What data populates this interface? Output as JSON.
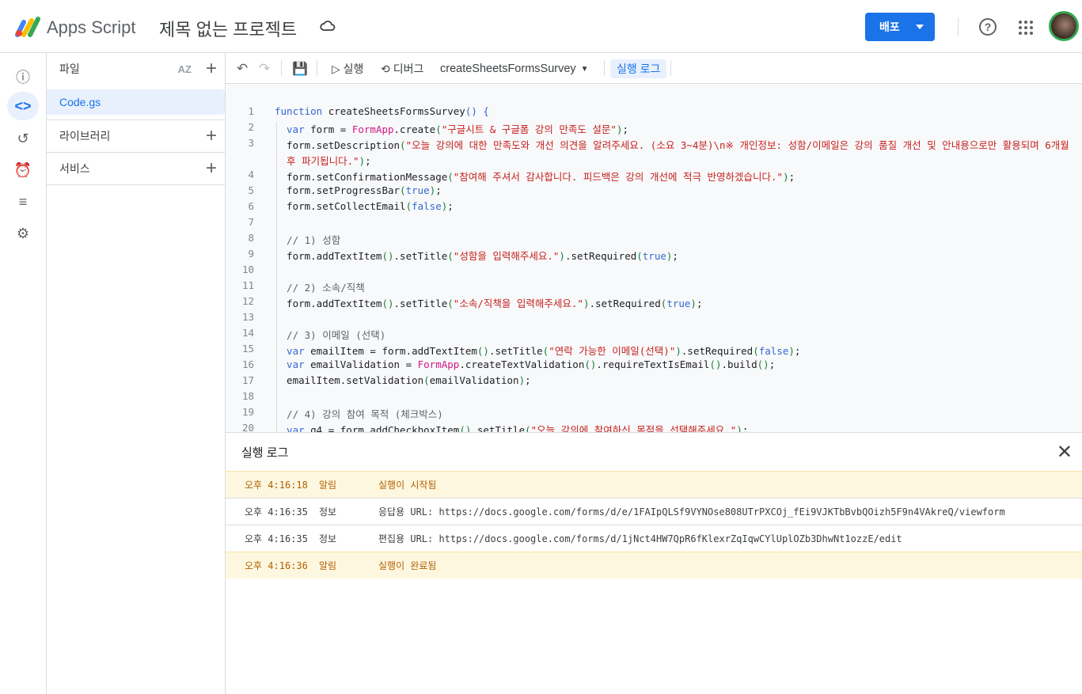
{
  "header": {
    "app_name": "Apps Script",
    "project_title": "제목 없는 프로젝트",
    "deploy_label": "배포",
    "help": "?"
  },
  "rail": [
    "info-icon",
    "code-icon",
    "history-icon",
    "trigger-icon",
    "executions-icon",
    "settings-icon"
  ],
  "files": {
    "title": "파일",
    "sort": "AZ",
    "items": [
      "Code.gs"
    ],
    "libraries": "라이브러리",
    "services": "서비스"
  },
  "toolbar": {
    "run": "▷ 실행",
    "debug": "디버그",
    "function": "createSheetsFormsSurvey",
    "log": "실행 로그"
  },
  "code": [
    {
      "n": "1",
      "seg": [
        [
          "k",
          "function "
        ],
        [
          "",
          "createSheetsFormsSurvey"
        ],
        [
          "k",
          "() {"
        ]
      ]
    },
    {
      "n": "2",
      "seg": [
        [
          "k",
          "  var "
        ],
        [
          "",
          "form = "
        ],
        [
          "cls",
          "FormApp"
        ],
        [
          "",
          ".create"
        ],
        [
          "p",
          "("
        ],
        [
          "s",
          "\"구글시트 & 구글폼 강의 만족도 설문\""
        ],
        [
          "p",
          ")"
        ],
        [
          "",
          ";"
        ]
      ]
    },
    {
      "n": "3",
      "seg": [
        [
          "",
          "  form.setDescription"
        ],
        [
          "p",
          "("
        ],
        [
          "s",
          "\"오늘 강의에 대한 만족도와 개선 의견을 알려주세요. (소요 3~4분)\\n※ 개인정보: 성함/이메일은 강의 품질 개선 및 안내용으로만 활용되며 6개월"
        ]
      ]
    },
    {
      "n": "",
      "seg": [
        [
          "s",
          "  후 파기됩니다.\""
        ],
        [
          "p",
          ")"
        ],
        [
          "",
          ";"
        ]
      ]
    },
    {
      "n": "4",
      "seg": [
        [
          "",
          "  form.setConfirmationMessage"
        ],
        [
          "p",
          "("
        ],
        [
          "s",
          "\"참여해 주셔서 감사합니다. 피드백은 강의 개선에 적극 반영하겠습니다.\""
        ],
        [
          "p",
          ")"
        ],
        [
          "",
          ";"
        ]
      ]
    },
    {
      "n": "5",
      "seg": [
        [
          "",
          "  form.setProgressBar"
        ],
        [
          "p",
          "("
        ],
        [
          "k",
          "true"
        ],
        [
          "p",
          ")"
        ],
        [
          "",
          ";"
        ]
      ]
    },
    {
      "n": "6",
      "seg": [
        [
          "",
          "  form.setCollectEmail"
        ],
        [
          "p",
          "("
        ],
        [
          "k",
          "false"
        ],
        [
          "p",
          ")"
        ],
        [
          "",
          ";"
        ]
      ]
    },
    {
      "n": "7",
      "seg": []
    },
    {
      "n": "8",
      "seg": [
        [
          "c",
          "  // 1) 성함"
        ]
      ]
    },
    {
      "n": "9",
      "seg": [
        [
          "",
          "  form.addTextItem"
        ],
        [
          "p",
          "()"
        ],
        [
          "",
          ".setTitle"
        ],
        [
          "p",
          "("
        ],
        [
          "s",
          "\"성함을 입력해주세요.\""
        ],
        [
          "p",
          ")"
        ],
        [
          "",
          ".setRequired"
        ],
        [
          "p",
          "("
        ],
        [
          "k",
          "true"
        ],
        [
          "p",
          ")"
        ],
        [
          "",
          ";"
        ]
      ]
    },
    {
      "n": "10",
      "seg": []
    },
    {
      "n": "11",
      "seg": [
        [
          "c",
          "  // 2) 소속/직책"
        ]
      ]
    },
    {
      "n": "12",
      "seg": [
        [
          "",
          "  form.addTextItem"
        ],
        [
          "p",
          "()"
        ],
        [
          "",
          ".setTitle"
        ],
        [
          "p",
          "("
        ],
        [
          "s",
          "\"소속/직책을 입력해주세요.\""
        ],
        [
          "p",
          ")"
        ],
        [
          "",
          ".setRequired"
        ],
        [
          "p",
          "("
        ],
        [
          "k",
          "true"
        ],
        [
          "p",
          ")"
        ],
        [
          "",
          ";"
        ]
      ]
    },
    {
      "n": "13",
      "seg": []
    },
    {
      "n": "14",
      "seg": [
        [
          "c",
          "  // 3) 이메일 (선택)"
        ]
      ]
    },
    {
      "n": "15",
      "seg": [
        [
          "k",
          "  var "
        ],
        [
          "",
          "emailItem = form.addTextItem"
        ],
        [
          "p",
          "()"
        ],
        [
          "",
          ".setTitle"
        ],
        [
          "p",
          "("
        ],
        [
          "s",
          "\"연락 가능한 이메일(선택)\""
        ],
        [
          "p",
          ")"
        ],
        [
          "",
          ".setRequired"
        ],
        [
          "p",
          "("
        ],
        [
          "k",
          "false"
        ],
        [
          "p",
          ")"
        ],
        [
          "",
          ";"
        ]
      ]
    },
    {
      "n": "16",
      "seg": [
        [
          "k",
          "  var "
        ],
        [
          "",
          "emailValidation = "
        ],
        [
          "cls",
          "FormApp"
        ],
        [
          "",
          ".createTextValidation"
        ],
        [
          "p",
          "()"
        ],
        [
          "",
          ".requireTextIsEmail"
        ],
        [
          "p",
          "()"
        ],
        [
          "",
          ".build"
        ],
        [
          "p",
          "()"
        ],
        [
          "",
          ";"
        ]
      ]
    },
    {
      "n": "17",
      "seg": [
        [
          "",
          "  emailItem.setValidation"
        ],
        [
          "p",
          "("
        ],
        [
          "",
          "emailValidation"
        ],
        [
          "p",
          ")"
        ],
        [
          "",
          ";"
        ]
      ]
    },
    {
      "n": "18",
      "seg": []
    },
    {
      "n": "19",
      "seg": [
        [
          "c",
          "  // 4) 강의 참여 목적 (체크박스)"
        ]
      ]
    },
    {
      "n": "20",
      "seg": [
        [
          "k",
          "  var "
        ],
        [
          "",
          "q4 = form.addCheckboxItem"
        ],
        [
          "p",
          "()"
        ],
        [
          "",
          ".setTitle"
        ],
        [
          "p",
          "("
        ],
        [
          "s",
          "\"오늘 강의에 참여하신 목적을 선택해주세요.\""
        ],
        [
          "p",
          ")"
        ],
        [
          "",
          ";"
        ]
      ]
    }
  ],
  "log": {
    "title": "실행 로그",
    "rows": [
      {
        "time": "오후 4:16:18",
        "level": "알림",
        "msg": "실행이 시작됨",
        "notice": true
      },
      {
        "time": "오후 4:16:35",
        "level": "정보",
        "msg": "응답용 URL: https://docs.google.com/forms/d/e/1FAIpQLSf9VYNOse808UTrPXCOj_fEi9VJKTbBvbQOizh5F9n4VAkreQ/viewform",
        "notice": false
      },
      {
        "time": "오후 4:16:35",
        "level": "정보",
        "msg": "편집용 URL: https://docs.google.com/forms/d/1jNct4HW7QpR6fKlexrZqIqwCYlUplOZb3DhwNt1ozzE/edit",
        "notice": false
      },
      {
        "time": "오후 4:16:36",
        "level": "알림",
        "msg": "실행이 완료됨",
        "notice": true
      }
    ]
  }
}
